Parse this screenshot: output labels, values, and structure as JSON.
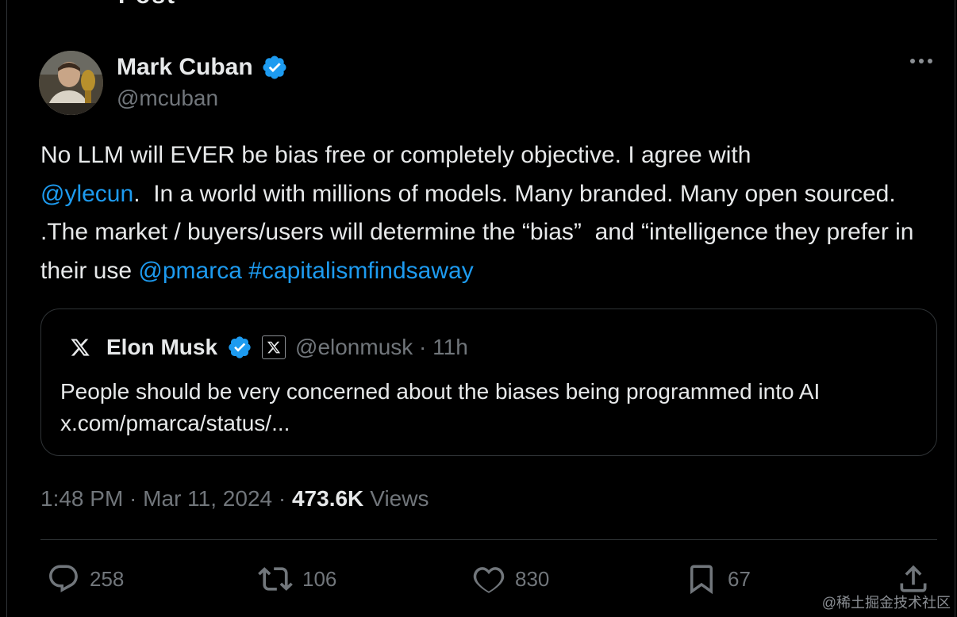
{
  "header": {
    "title": "Post"
  },
  "author": {
    "name": "Mark Cuban",
    "handle": "@mcuban",
    "verified": true
  },
  "tweet": {
    "segments": [
      {
        "text": "No LLM will EVER be bias free or completely objective. I agree with\n",
        "link": false
      },
      {
        "text": "@ylecun",
        "link": true
      },
      {
        "text": ".  In a world with millions of models. Many branded. Many open sourced. .The market / buyers/users will determine the “bias”  and “intelligence they prefer in their use ",
        "link": false
      },
      {
        "text": "@pmarca",
        "link": true
      },
      {
        "text": " ",
        "link": false
      },
      {
        "text": "#capitalismfindsaway",
        "link": true
      }
    ]
  },
  "quoted": {
    "name": "Elon Musk",
    "handle_time": "@elonmusk · 11h",
    "text": "People should be very concerned about the biases being programmed into AI",
    "link": "x.com/pmarca/status/..."
  },
  "meta": {
    "time": "1:48 PM",
    "date": "Mar 11, 2024",
    "views_count": "473.6K",
    "views_label": "Views",
    "separator": " · "
  },
  "actions": {
    "replies": "258",
    "reposts": "106",
    "likes": "830",
    "bookmarks": "67"
  },
  "watermark": "@稀土掘金技术社区",
  "colors": {
    "link": "#1d9bf0",
    "verified": "#1d9bf0",
    "muted": "#71767b",
    "text": "#e7e9ea",
    "border": "#2f3336"
  }
}
